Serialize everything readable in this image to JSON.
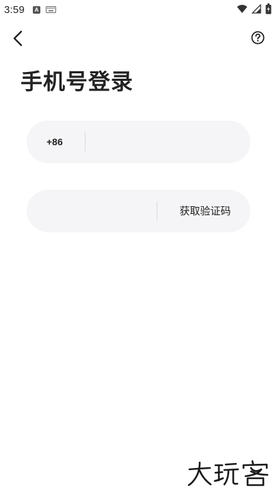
{
  "status_bar": {
    "time": "3:59",
    "notification_icons": [
      "a-notification-icon",
      "keyboard-notification-icon"
    ],
    "system_icons": [
      "wifi-icon",
      "signal-icon",
      "battery-icon"
    ]
  },
  "app_bar": {
    "back_icon": "chevron-left-icon",
    "help_icon": "question-circle-icon"
  },
  "page": {
    "title": "手机号登录"
  },
  "phone_field": {
    "country_code": "+86",
    "value": "",
    "placeholder": ""
  },
  "code_field": {
    "value": "",
    "placeholder": "",
    "get_code_label": "获取验证码"
  },
  "watermark": {
    "text": "大玩客"
  },
  "colors": {
    "background": "#ffffff",
    "field_background": "#f5f5f7",
    "text": "#222222",
    "divider": "#d8d8db"
  }
}
